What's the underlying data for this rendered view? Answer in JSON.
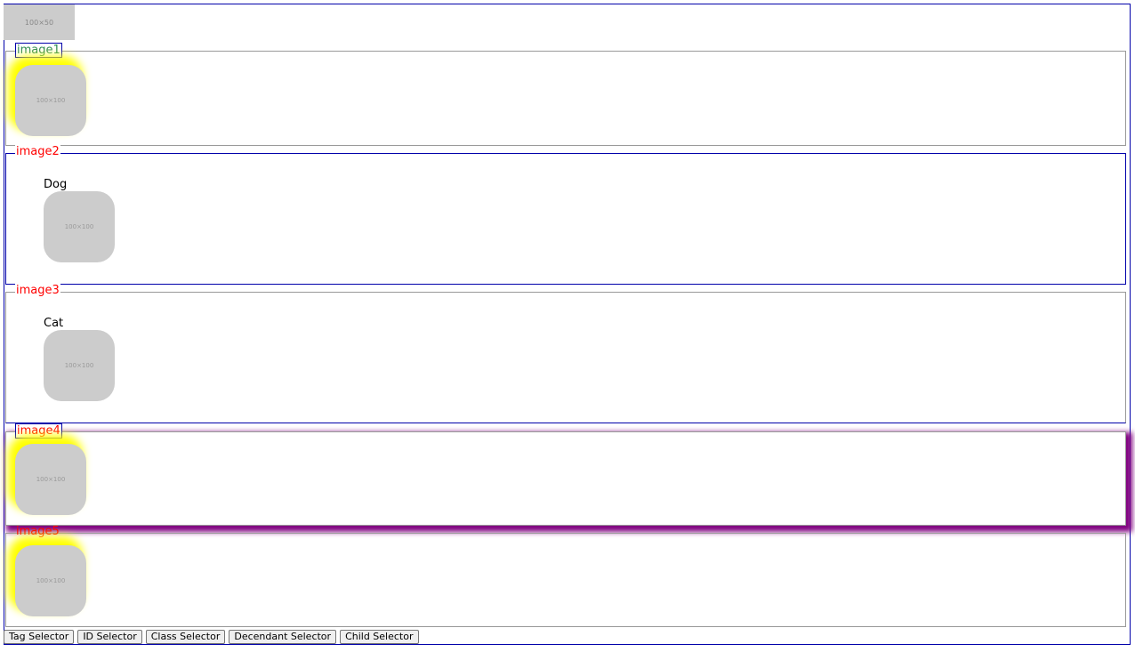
{
  "header_placeholder": "100×50",
  "sections": [
    {
      "legend": "image1",
      "legend_color": "#2e8b57",
      "placeholder": "100×100"
    },
    {
      "legend": "image2",
      "legend_color": "#ff0000",
      "caption": "Dog",
      "placeholder": "100×100"
    },
    {
      "legend": "image3",
      "legend_color": "#ff0000",
      "caption": "Cat",
      "placeholder": "100×100"
    },
    {
      "legend": "image4",
      "legend_color": "#ff0000",
      "placeholder": "100×100"
    },
    {
      "legend": "image5",
      "legend_color": "#ff0000",
      "placeholder": "100×100"
    }
  ],
  "buttons": [
    "Tag Selector",
    "ID Selector",
    "Class Selector",
    "Decendant Selector",
    "Child Selector"
  ],
  "colors": {
    "frame_border": "#0000aa",
    "glow": "#ffff00",
    "purple_shadow": "#800080",
    "placeholder_bg": "#cccccc"
  }
}
